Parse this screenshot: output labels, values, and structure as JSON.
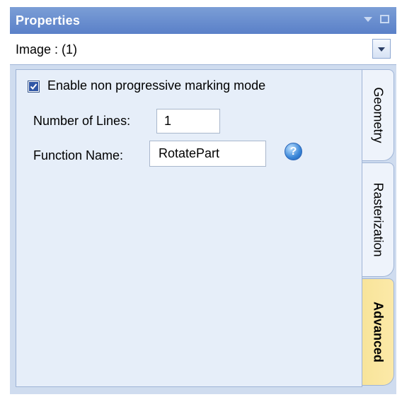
{
  "window": {
    "title": "Properties"
  },
  "selector": {
    "value": "Image : (1)"
  },
  "options": {
    "enable_label": "Enable non progressive marking mode",
    "enable_checked": true,
    "lines_label": "Number of Lines:",
    "lines_value": "1",
    "function_label": "Function Name:",
    "function_value": "RotatePart",
    "help_glyph": "?"
  },
  "tabs": [
    {
      "label": "Geometry",
      "active": false
    },
    {
      "label": "Rasterization",
      "active": false
    },
    {
      "label": "Advanced",
      "active": true
    }
  ],
  "colors": {
    "titlebar": "#6b8fd0",
    "panel_bg": "#e6eef9",
    "active_tab": "#fce9a8",
    "checkbox_fill": "#2e55a5"
  },
  "icons": {
    "pin": "pin-icon",
    "restore": "restore-icon",
    "dropdown": "chevron-down-icon",
    "help": "help-icon",
    "check": "checkmark-icon"
  }
}
